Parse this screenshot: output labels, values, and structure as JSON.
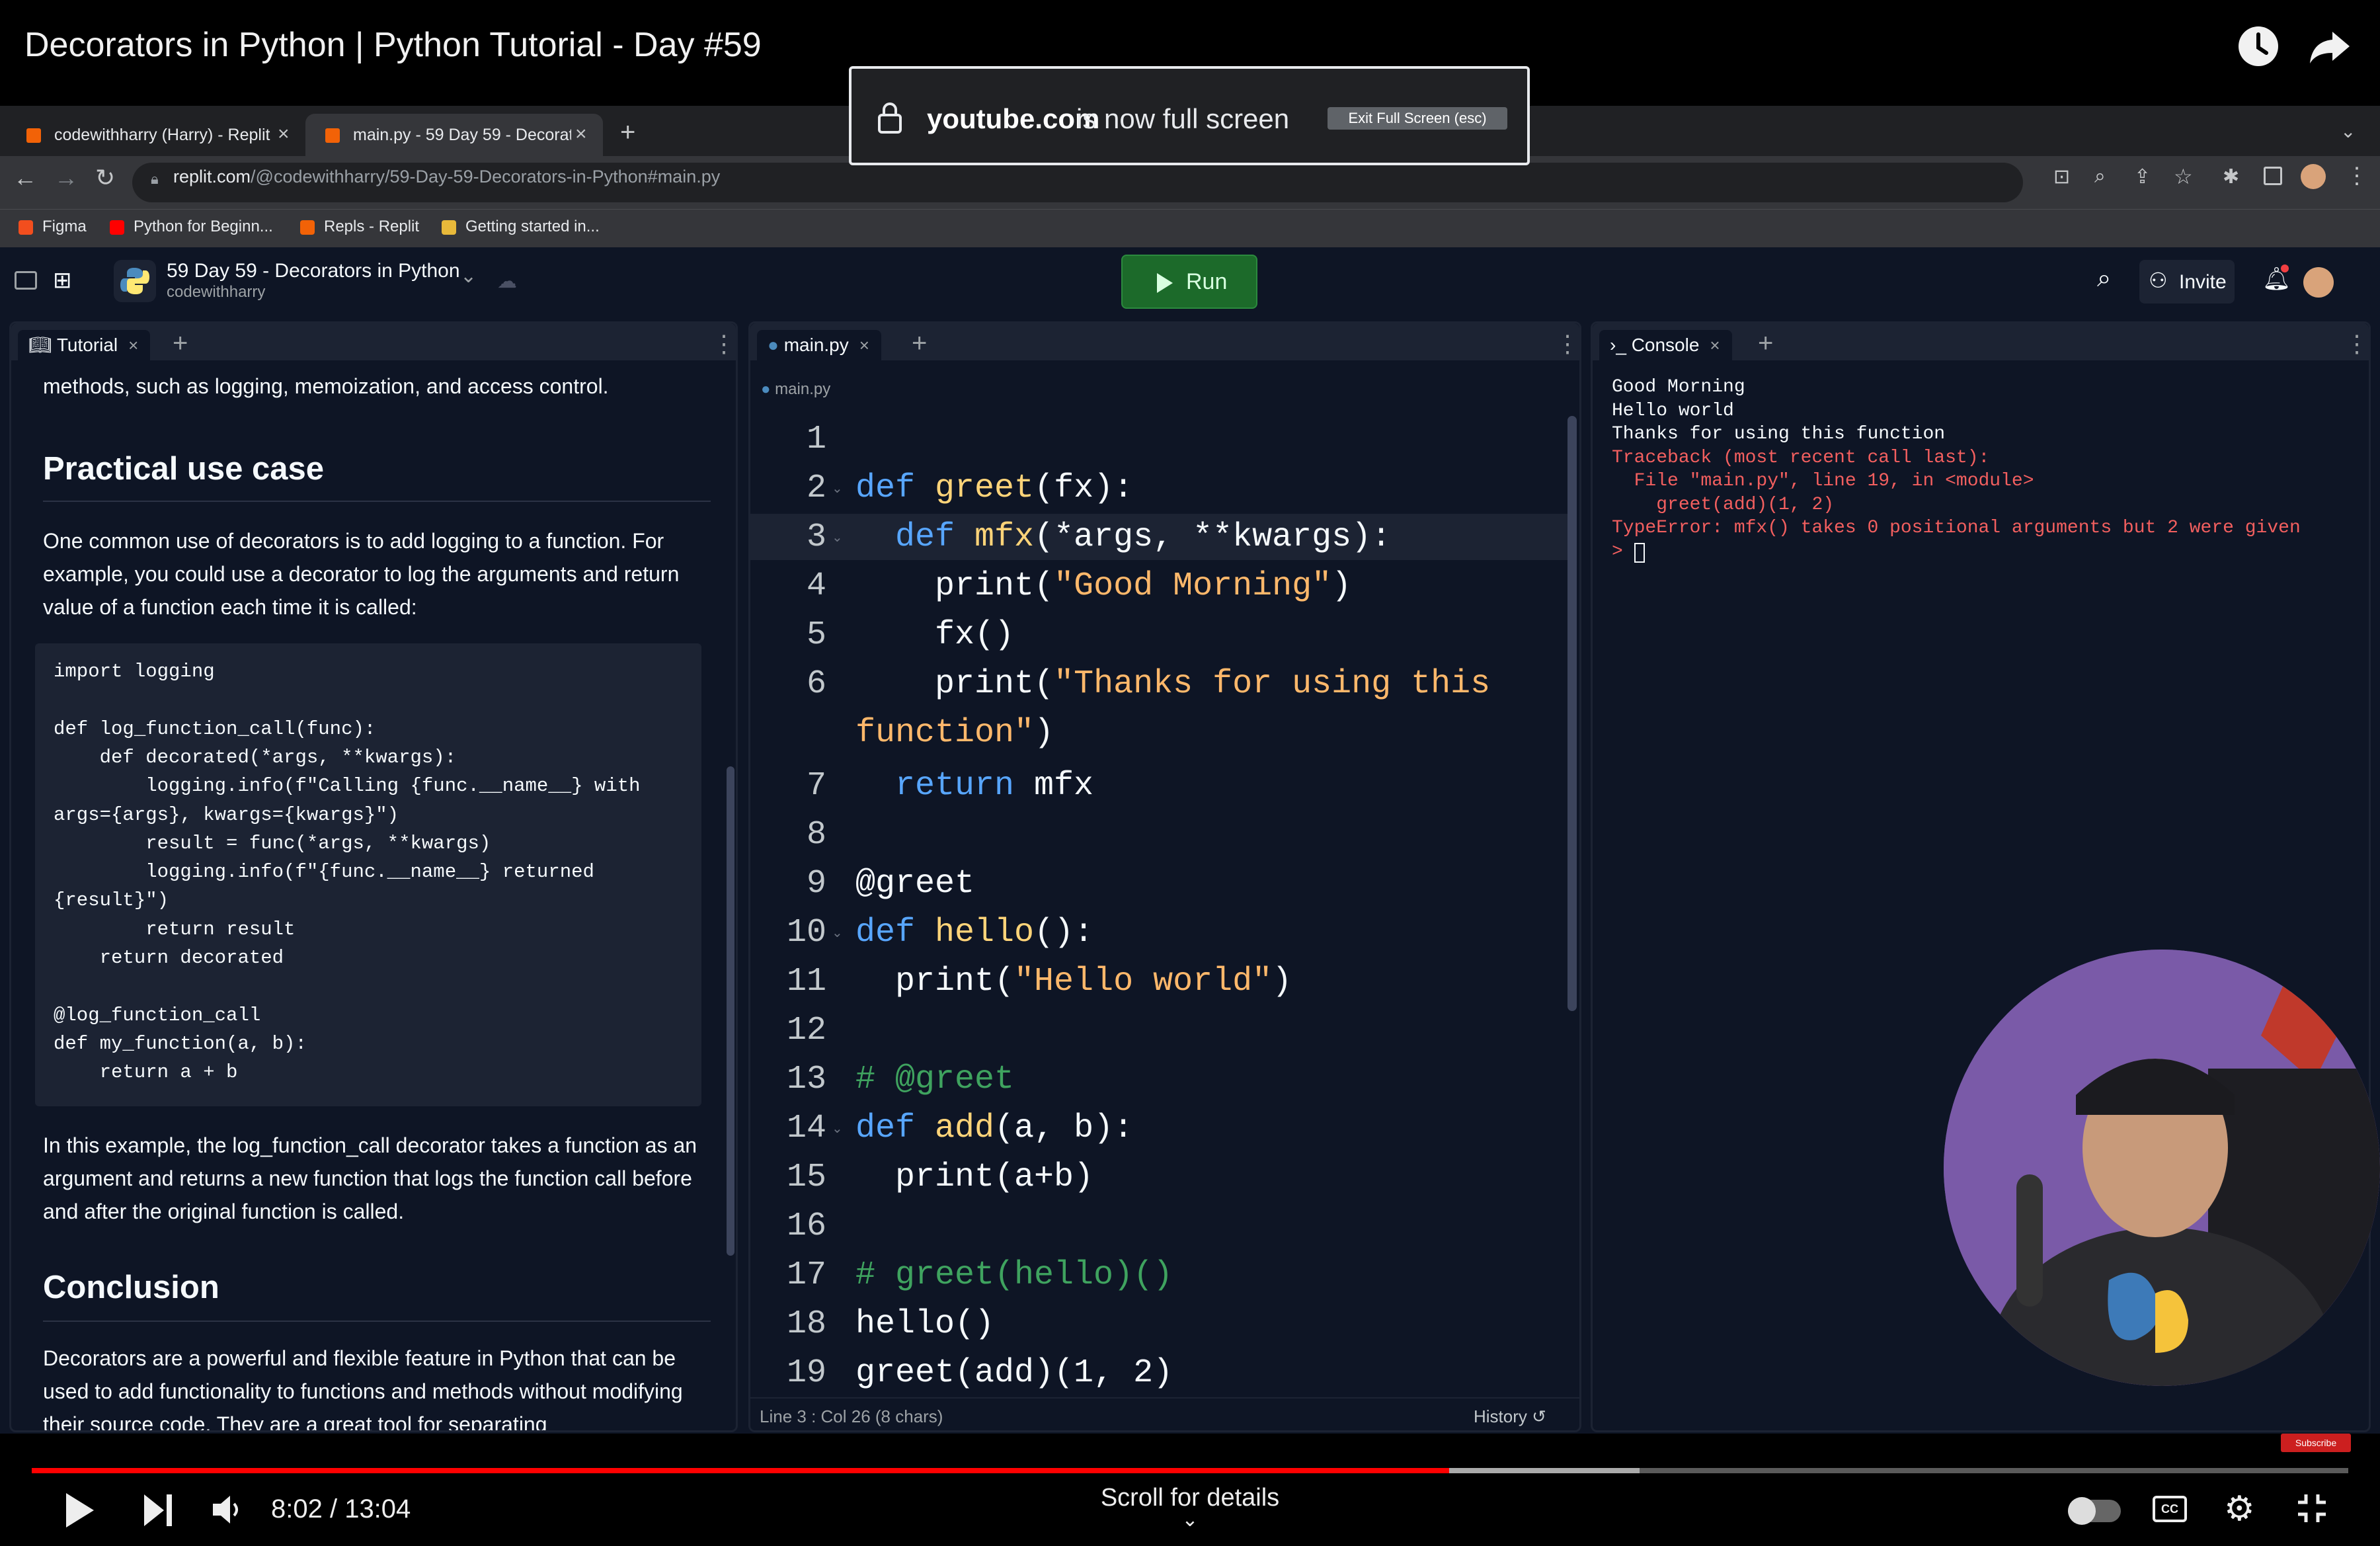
{
  "video": {
    "title": "Decorators in Python | Python Tutorial - Day #59",
    "time": "8:02 / 13:04",
    "progress": 0.612,
    "buffered": 0.694,
    "scroll_hint": "Scroll for details",
    "subscribe_badge": "Subscribe"
  },
  "fullscreen_notice": {
    "domain": "youtube.com",
    "message": "is now full screen",
    "exit_label": "Exit Full Screen (esc)"
  },
  "browser": {
    "tabs": [
      {
        "label": "codewithharry (Harry) - Replit"
      },
      {
        "label": "main.py - 59 Day 59 - Decorat"
      }
    ],
    "url_host": "replit.com",
    "url_path": "/@codewithharry/59-Day-59-Decorators-in-Python#main.py",
    "bookmarks": [
      "Figma",
      "Python for Beginn...",
      "Repls - Replit",
      "Getting started in..."
    ]
  },
  "replit": {
    "repl_name": "59 Day 59 - Decorators in Python",
    "owner": "codewithharry",
    "run_label": "Run",
    "invite_label": "Invite"
  },
  "tutorial": {
    "tab_label": "Tutorial",
    "intro_tail": "methods, such as logging, memoization, and access control.",
    "heading1": "Practical use case",
    "para1": "One common use of decorators is to add logging to a function. For example, you could use a decorator to log the arguments and return value of a function each time it is called:",
    "code": [
      "import logging",
      "",
      "def log_function_call(func):",
      "    def decorated(*args, **kwargs):",
      "        logging.info(f\"Calling {func.__name__} with",
      "args={args}, kwargs={kwargs}\")",
      "        result = func(*args, **kwargs)",
      "        logging.info(f\"{func.__name__} returned",
      "{result}\")",
      "        return result",
      "    return decorated",
      "",
      "@log_function_call",
      "def my_function(a, b):",
      "    return a + b"
    ],
    "para2": "In this example, the log_function_call decorator takes a function as an argument and returns a new function that logs the function call before and after the original function is called.",
    "heading2": "Conclusion",
    "para3": "Decorators are a powerful and flexible feature in Python that can be used to add functionality to functions and methods without modifying their source code. They are a great tool for separating"
  },
  "editor": {
    "tab_label": "main.py",
    "breadcrumb": "main.py",
    "status": "Line 3 : Col 26 (8 chars)",
    "history_label": "History",
    "line_numbers": [
      "1",
      "2",
      "3",
      "4",
      "5",
      "6",
      "",
      "7",
      "8",
      "9",
      "10",
      "11",
      "12",
      "13",
      "14",
      "15",
      "16",
      "17",
      "18",
      "19"
    ]
  },
  "console": {
    "tab_label": "Console",
    "output": [
      {
        "text": "Good Morning",
        "kind": "ok"
      },
      {
        "text": "Hello world",
        "kind": "ok"
      },
      {
        "text": "Thanks for using this function",
        "kind": "ok"
      },
      {
        "text": "Traceback (most recent call last):",
        "kind": "err"
      },
      {
        "text": "  File \"main.py\", line 19, in <module>",
        "kind": "err"
      },
      {
        "text": "    greet(add)(1, 2)",
        "kind": "err"
      },
      {
        "text": "TypeError: mfx() takes 0 positional arguments but 2 were given",
        "kind": "err"
      }
    ],
    "prompt": "> "
  },
  "colors": {
    "accent_run": "#1c6a2a",
    "progress": "#ff0000",
    "error": "#f25f5f"
  }
}
